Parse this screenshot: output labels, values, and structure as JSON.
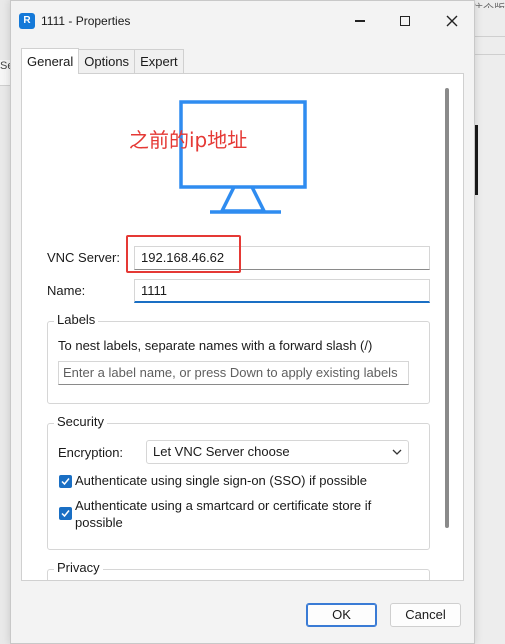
{
  "window": {
    "app_icon_letter": "R",
    "title": "1111 - Properties"
  },
  "tabs": [
    {
      "label": "General",
      "active": true
    },
    {
      "label": "Options",
      "active": false
    },
    {
      "label": "Expert",
      "active": false
    }
  ],
  "annotation": {
    "text": "之前的ip地址",
    "color": "#e53935"
  },
  "fields": {
    "vnc_server_label": "VNC Server:",
    "vnc_server_value": "192.168.46.62",
    "name_label": "Name:",
    "name_value": "1111"
  },
  "labels_group": {
    "title": "Labels",
    "hint": "To nest labels, separate names with a forward slash (/)",
    "placeholder": "Enter a label name, or press Down to apply existing labels"
  },
  "security_group": {
    "title": "Security",
    "encryption_label": "Encryption:",
    "encryption_value": "Let VNC Server choose",
    "sso_label": "Authenticate using single sign-on (SSO) if possible",
    "sso_checked": true,
    "smartcard_label_line1": "Authenticate using a smartcard or certificate store if",
    "smartcard_label_line2": "possible",
    "smartcard_checked": true
  },
  "privacy_group": {
    "title": "Privacy"
  },
  "footer": {
    "ok_label": "OK",
    "cancel_label": "Cancel"
  },
  "background": {
    "top_text": "注个版个攻荣",
    "left_tab_text": "Se"
  },
  "colors": {
    "accent": "#1a6fc4",
    "monitor": "#2f8cf0"
  },
  "icons": {
    "app": "realvnc-icon",
    "minimize": "minimize-icon",
    "maximize": "maximize-icon",
    "close": "close-icon",
    "monitor": "monitor-icon",
    "dropdown": "chevron-down-icon",
    "check": "checkmark-icon"
  }
}
